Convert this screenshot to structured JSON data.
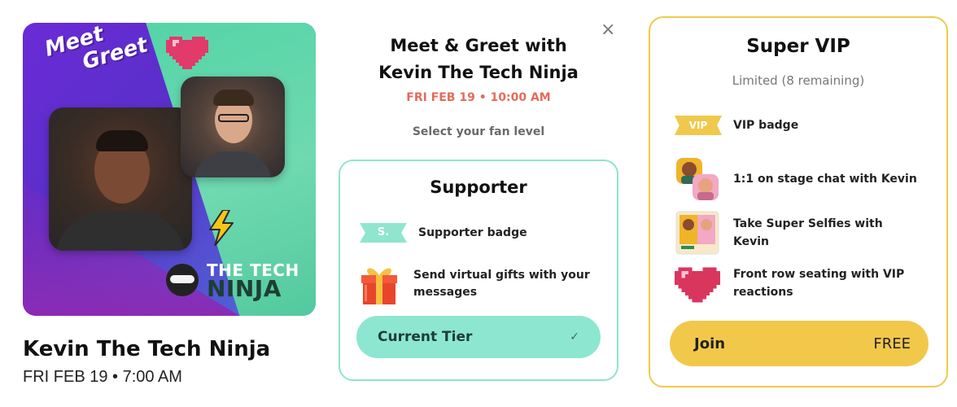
{
  "poster": {
    "meet_line1": "Meet",
    "meet_line2": "Greet",
    "logo_top": "THE TECH",
    "logo_bottom": "NINJA",
    "icons": [
      "pixel-heart-icon",
      "lightning-bolt-icon",
      "ninja-mask-icon"
    ]
  },
  "host": {
    "name": "Kevin The Tech Ninja",
    "date": "FRI FEB 19 • 7:00 AM"
  },
  "dialog": {
    "close_glyph": "×",
    "title_line1": "Meet & Greet with",
    "title_line2": "Kevin The Tech Ninja",
    "time": "FRI FEB 19 • 10:00 AM",
    "select_prompt": "Select your fan level"
  },
  "supporter": {
    "title": "Supporter",
    "badge_text": "S.",
    "perks": [
      {
        "text": "Supporter badge",
        "icon": "supporter-badge-icon"
      },
      {
        "text": "Send virtual gifts with your messages",
        "icon": "gift-icon"
      }
    ],
    "button_label": "Current Tier",
    "button_check": "✓"
  },
  "vip": {
    "title": "Super VIP",
    "availability": "Limited (8 remaining)",
    "badge_text": "VIP",
    "perks": [
      {
        "text": "VIP badge",
        "icon": "vip-badge-icon"
      },
      {
        "text": "1:1 on stage chat with Kevin",
        "icon": "chat-avatars-icon"
      },
      {
        "text": "Take Super Selfies with Kevin",
        "icon": "selfie-icon"
      },
      {
        "text": "Front row seating with VIP reactions",
        "icon": "pixel-heart-icon"
      }
    ],
    "join_label": "Join",
    "join_price": "FREE"
  },
  "colors": {
    "supporter_accent": "#8fe5cd",
    "vip_accent": "#f0c94c",
    "time_red": "#e56b5b"
  }
}
